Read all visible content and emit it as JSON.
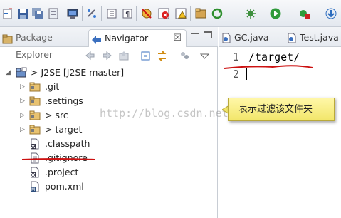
{
  "toolbar": {
    "icons": [
      "new-icon",
      "save-icon",
      "save-all-icon",
      "print-icon",
      "link-icon",
      "grid-icon",
      "paragraph-icon",
      "bug-off-icon",
      "error-icon",
      "warning-icon",
      "package-icon",
      "refresh-icon",
      "gear-bug-icon",
      "run-icon",
      "run-config-icon",
      "arrow-down-icon"
    ]
  },
  "left_panel": {
    "tabs": [
      {
        "label": "Package Explorer",
        "icon": "package-explorer-icon"
      },
      {
        "label": "Navigator",
        "icon": "navigator-icon",
        "close": "☒"
      }
    ]
  },
  "tree": {
    "project": {
      "label": "> J2SE  [J2SE master]"
    },
    "items": [
      {
        "label": ".git",
        "type": "folder",
        "expandable": true
      },
      {
        "label": ".settings",
        "type": "folder",
        "expandable": true
      },
      {
        "label": "> src",
        "type": "folder",
        "expandable": true
      },
      {
        "label": "> target",
        "type": "folder",
        "expandable": true
      },
      {
        "label": ".classpath",
        "type": "file-x"
      },
      {
        "label": ".gitignore",
        "type": "file-text"
      },
      {
        "label": ".project",
        "type": "file-x"
      },
      {
        "label": "pom.xml",
        "type": "file-xml"
      }
    ]
  },
  "editor": {
    "tabs": [
      {
        "label": "GC.java",
        "icon": "java-file-icon"
      },
      {
        "label": "Test.java",
        "icon": "java-file-icon"
      }
    ],
    "lines": [
      {
        "number": "1",
        "text": "/target/"
      },
      {
        "number": "2",
        "text": ""
      }
    ]
  },
  "annotation": {
    "text": "表示过滤该文件夹"
  },
  "watermark": "http://blog.csdn.net/",
  "colors": {
    "annotation_bg": "#f7ee8a",
    "underline": "#cc1111",
    "accent": "#2d6dbf"
  }
}
